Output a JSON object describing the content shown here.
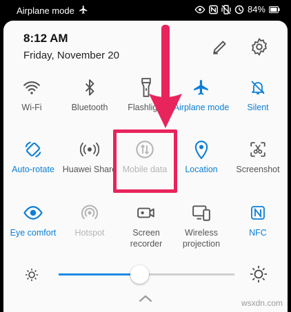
{
  "status_bar": {
    "carrier_text": "Airplane mode",
    "battery": "84%",
    "icons": [
      "airplane-icon",
      "eye-icon",
      "nfc-icon",
      "vibrate-icon",
      "alarm-icon",
      "battery-icon"
    ]
  },
  "header": {
    "time": "8:12 AM",
    "date": "Friday, November 20",
    "icons": [
      "edit-pencil-icon",
      "settings-gear-icon"
    ]
  },
  "tiles": [
    {
      "label": "Wi-Fi",
      "icon": "wifi-icon",
      "state": "off"
    },
    {
      "label": "Bluetooth",
      "icon": "bluetooth-icon",
      "state": "off"
    },
    {
      "label": "Flashlight",
      "icon": "flashlight-icon",
      "state": "off"
    },
    {
      "label": "Airplane mode",
      "icon": "airplane-icon",
      "state": "on"
    },
    {
      "label": "Silent",
      "icon": "bell-off-icon",
      "state": "on"
    },
    {
      "label": "Auto-rotate",
      "icon": "auto-rotate-icon",
      "state": "on"
    },
    {
      "label": "Huawei Share",
      "icon": "huawei-share-icon",
      "state": "off"
    },
    {
      "label": "Mobile data",
      "icon": "mobile-data-icon",
      "state": "disabled"
    },
    {
      "label": "Location",
      "icon": "location-pin-icon",
      "state": "on"
    },
    {
      "label": "Screenshot",
      "icon": "screenshot-icon",
      "state": "off"
    },
    {
      "label": "Eye comfort",
      "icon": "eye-icon",
      "state": "on"
    },
    {
      "label": "Hotspot",
      "icon": "hotspot-icon",
      "state": "disabled"
    },
    {
      "label": "Screen recorder",
      "icon": "screen-recorder-icon",
      "state": "off"
    },
    {
      "label": "Wireless projection",
      "icon": "wireless-projection-icon",
      "state": "off"
    },
    {
      "label": "NFC",
      "icon": "nfc-icon",
      "state": "on"
    }
  ],
  "brightness": {
    "level_fraction": 0.35,
    "icons": [
      "brightness-low-icon",
      "brightness-high-icon"
    ]
  },
  "colors": {
    "accent": "#0b7fd6",
    "highlight": "#e8245c",
    "off": "#555555",
    "disabled": "#b5b5b5"
  },
  "annotation": {
    "icon": "down-arrow-icon",
    "target": "Mobile data"
  },
  "watermark": "wsxdn.com"
}
